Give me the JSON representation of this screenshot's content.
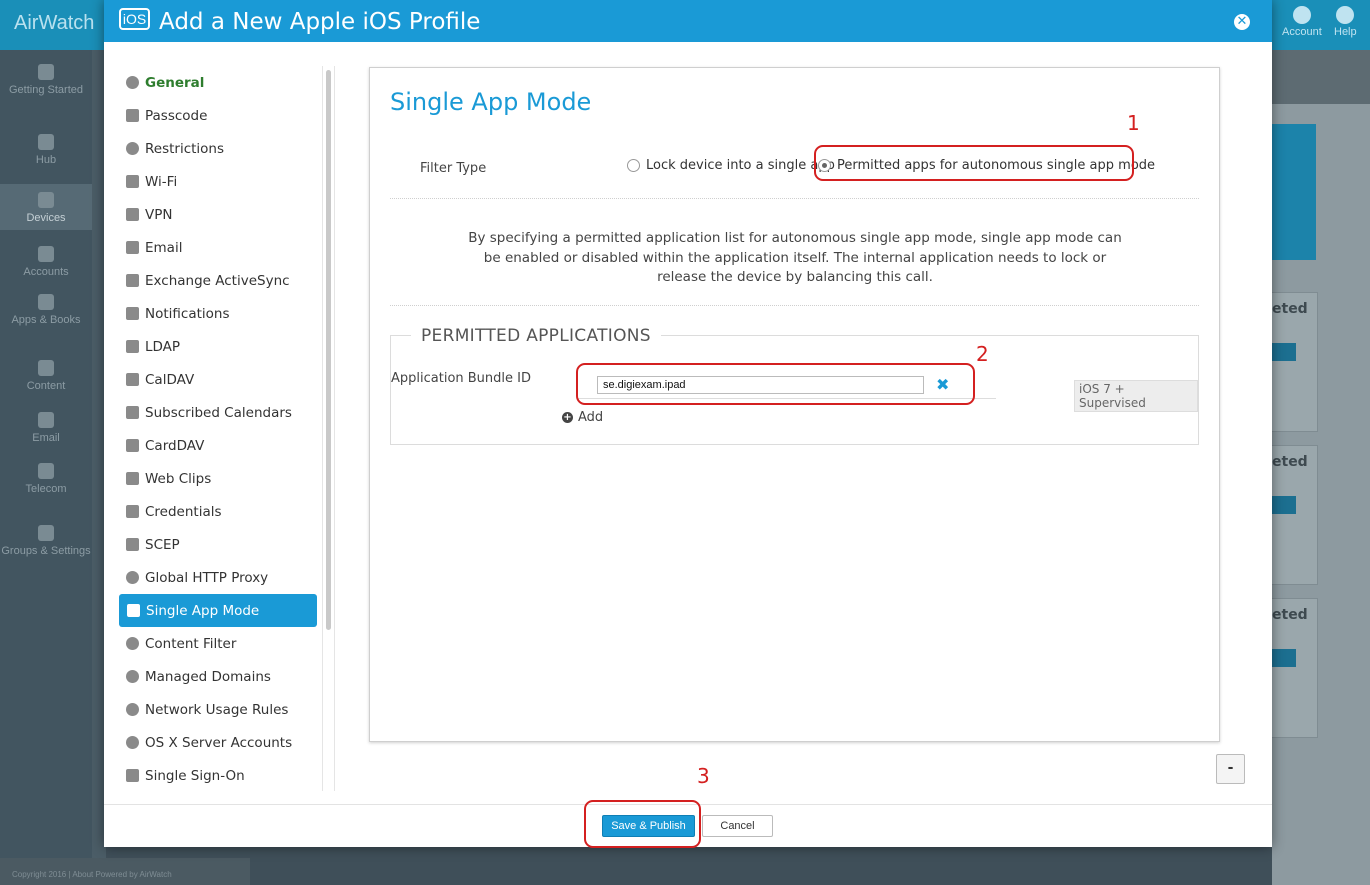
{
  "background": {
    "logo": "AirWatch",
    "top_icons": [
      {
        "label": "Account",
        "icon": "user-icon"
      },
      {
        "label": "Help",
        "icon": "help-icon"
      }
    ],
    "nav": [
      {
        "label": "Getting Started",
        "icon": "check-icon"
      },
      {
        "label": "Hub",
        "icon": "hub-icon"
      },
      {
        "label": "Devices",
        "icon": "phone-icon",
        "active": true
      },
      {
        "label": "Accounts",
        "icon": "users-icon"
      },
      {
        "label": "Apps & Books",
        "icon": "grid-icon"
      },
      {
        "label": "Content",
        "icon": "document-icon"
      },
      {
        "label": "Email",
        "icon": "mail-icon"
      },
      {
        "label": "Telecom",
        "icon": "telephone-icon"
      },
      {
        "label": "Groups & Settings",
        "icon": "tools-icon"
      }
    ],
    "cards": [
      "eted",
      "eted",
      "eted"
    ],
    "footer": "Copyright 2016 | About   Powered by AirWatch"
  },
  "modal": {
    "badge": "iOS",
    "title": "Add a New Apple iOS Profile",
    "close_icon": "close-icon",
    "nav": [
      {
        "label": "General",
        "icon": "info-icon"
      },
      {
        "label": "Passcode",
        "icon": "key-icon"
      },
      {
        "label": "Restrictions",
        "icon": "restricted-icon"
      },
      {
        "label": "Wi-Fi",
        "icon": "wifi-icon"
      },
      {
        "label": "VPN",
        "icon": "lock-icon"
      },
      {
        "label": "Email",
        "icon": "envelope-icon"
      },
      {
        "label": "Exchange ActiveSync",
        "icon": "sync-icon"
      },
      {
        "label": "Notifications",
        "icon": "notification-icon"
      },
      {
        "label": "LDAP",
        "icon": "book-icon"
      },
      {
        "label": "CalDAV",
        "icon": "calendar-icon"
      },
      {
        "label": "Subscribed Calendars",
        "icon": "calendar-plus-icon"
      },
      {
        "label": "CardDAV",
        "icon": "contact-card-icon"
      },
      {
        "label": "Web Clips",
        "icon": "scissors-icon"
      },
      {
        "label": "Credentials",
        "icon": "shield-icon"
      },
      {
        "label": "SCEP",
        "icon": "exchange-arrows-icon"
      },
      {
        "label": "Global HTTP Proxy",
        "icon": "globe-icon"
      },
      {
        "label": "Single App Mode",
        "icon": "single-app-lock-icon",
        "active": true
      },
      {
        "label": "Content Filter",
        "icon": "compass-icon"
      },
      {
        "label": "Managed Domains",
        "icon": "globe-icon"
      },
      {
        "label": "Network Usage Rules",
        "icon": "globe-network-icon"
      },
      {
        "label": "OS X Server Accounts",
        "icon": "server-globe-icon"
      },
      {
        "label": "Single Sign-On",
        "icon": "edit-icon"
      }
    ],
    "panel": {
      "title": "Single App Mode",
      "filter_type_label": "Filter Type",
      "radio_options": [
        {
          "label": "Lock device into a single app",
          "selected": false
        },
        {
          "label": "Permitted apps for autonomous single app mode",
          "selected": true
        }
      ],
      "description": "By specifying a permitted application list for autonomous single app mode, single app mode can be enabled or disabled within the application itself. The internal application needs to lock or release the device by balancing this call.",
      "permitted_legend": "PERMITTED APPLICATIONS",
      "bundle_id_label": "Application Bundle ID",
      "bundle_id_value": "se.digiexam.ipad",
      "remove_icon": "remove-x-icon",
      "add_label": "Add",
      "requirement_tag": "iOS 7 + Supervised"
    },
    "minus_label": "-",
    "save_label": "Save & Publish",
    "cancel_label": "Cancel"
  },
  "annotations": [
    "1",
    "2",
    "3"
  ],
  "colors": {
    "accent": "#1a9ad6",
    "annotation_red": "#d42020",
    "general_green": "#2e7d2e"
  }
}
